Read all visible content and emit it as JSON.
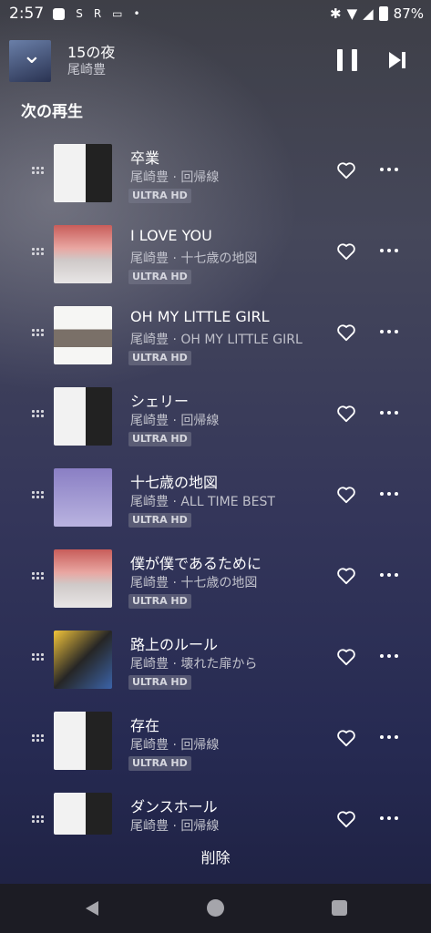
{
  "status": {
    "time": "2:57",
    "left_icons": [
      "S",
      "R"
    ],
    "battery": "87%"
  },
  "now_playing": {
    "title": "15の夜",
    "artist": "尾崎豊"
  },
  "queue": {
    "heading": "次の再生",
    "items": [
      {
        "title": "卒業",
        "subtitle": "尾崎豊 · 回帰線",
        "badge": "ULTRA HD"
      },
      {
        "title": "I LOVE YOU",
        "subtitle": "尾崎豊 · 十七歳の地図",
        "badge": "ULTRA HD"
      },
      {
        "title": "OH MY LITTLE GIRL",
        "subtitle": "尾崎豊 · OH MY LITTLE GIRL",
        "badge": "ULTRA HD"
      },
      {
        "title": "シェリー",
        "subtitle": "尾崎豊 · 回帰線",
        "badge": "ULTRA HD"
      },
      {
        "title": "十七歳の地図",
        "subtitle": "尾崎豊 · ALL TIME BEST",
        "badge": "ULTRA HD"
      },
      {
        "title": "僕が僕であるために",
        "subtitle": "尾崎豊 · 十七歳の地図",
        "badge": "ULTRA HD"
      },
      {
        "title": "路上のルール",
        "subtitle": "尾崎豊 · 壊れた扉から",
        "badge": "ULTRA HD"
      },
      {
        "title": "存在",
        "subtitle": "尾崎豊 · 回帰線",
        "badge": "ULTRA HD"
      },
      {
        "title": "ダンスホール",
        "subtitle": "尾崎豊 · 回帰線",
        "badge": ""
      }
    ]
  },
  "delete_label": "削除"
}
